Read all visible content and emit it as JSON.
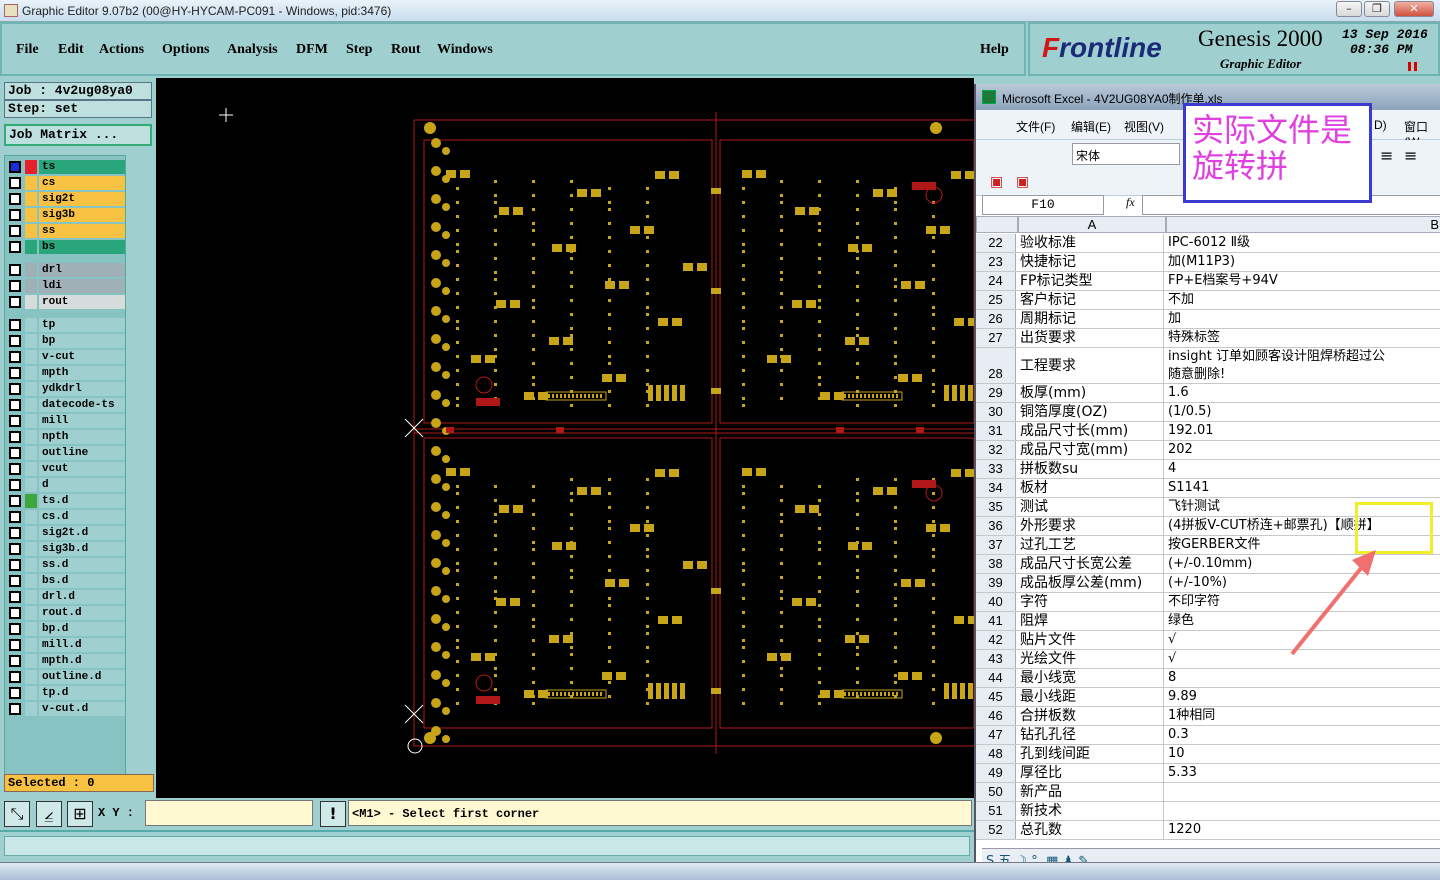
{
  "window": {
    "title": "Graphic Editor 9.07b2 (00@HY-HYCAM-PC091 - Windows, pid:3476)",
    "controls": [
      "–",
      "❐",
      "✕"
    ]
  },
  "menu": {
    "items": [
      "File",
      "Edit",
      "Actions",
      "Options",
      "Analysis",
      "DFM",
      "Step",
      "Rout",
      "Windows"
    ],
    "help": "Help"
  },
  "brand": {
    "logo_prefix": "F",
    "logo_rest": "rontline",
    "product": "Genesis 2000",
    "subtitle": "Graphic Editor",
    "date_line1": "13 Sep 2016",
    "date_line2": "08:36 PM"
  },
  "job": {
    "job_label": "Job : 4v2ug08ya0",
    "step_label": "Step: set",
    "matrix_button": "Job Matrix ..."
  },
  "layers": [
    {
      "name": "ts",
      "color": "#2aa67c",
      "mark": "#e8202a",
      "active": true
    },
    {
      "name": "cs",
      "color": "#f7c141"
    },
    {
      "name": "sig2t",
      "color": "#f7c141"
    },
    {
      "name": "sig3b",
      "color": "#f7c141"
    },
    {
      "name": "ss",
      "color": "#f7c141"
    },
    {
      "name": "bs",
      "color": "#2aa67c"
    },
    {
      "name": "drl",
      "color": "#9fb0b6"
    },
    {
      "name": "ldi",
      "color": "#9fb0b6"
    },
    {
      "name": "rout",
      "color": "#d6dcdc"
    },
    {
      "name": "tp",
      "color": "#9fd0cf"
    },
    {
      "name": "bp",
      "color": "#9fd0cf"
    },
    {
      "name": "v-cut",
      "color": "#9fd0cf"
    },
    {
      "name": "mpth",
      "color": "#9fd0cf"
    },
    {
      "name": "ydkdrl",
      "color": "#9fd0cf"
    },
    {
      "name": "datecode-ts",
      "color": "#9fd0cf"
    },
    {
      "name": "mill",
      "color": "#9fd0cf"
    },
    {
      "name": "npth",
      "color": "#9fd0cf"
    },
    {
      "name": "outline",
      "color": "#9fd0cf"
    },
    {
      "name": "vcut",
      "color": "#9fd0cf"
    },
    {
      "name": "d",
      "color": "#9fd0cf"
    },
    {
      "name": "ts.d",
      "color": "#9fd0cf",
      "mark": "#3fa63f"
    },
    {
      "name": "cs.d",
      "color": "#9fd0cf",
      "pen": true
    },
    {
      "name": "sig2t.d",
      "color": "#9fd0cf",
      "pen": true
    },
    {
      "name": "sig3b.d",
      "color": "#9fd0cf",
      "pen": true
    },
    {
      "name": "ss.d",
      "color": "#9fd0cf",
      "pen": true
    },
    {
      "name": "bs.d",
      "color": "#9fd0cf"
    },
    {
      "name": "drl.d",
      "color": "#9fd0cf"
    },
    {
      "name": "rout.d",
      "color": "#9fd0cf"
    },
    {
      "name": "bp.d",
      "color": "#9fd0cf"
    },
    {
      "name": "mill.d",
      "color": "#9fd0cf",
      "pen": true
    },
    {
      "name": "mpth.d",
      "color": "#9fd0cf"
    },
    {
      "name": "outline.d",
      "color": "#9fd0cf"
    },
    {
      "name": "tp.d",
      "color": "#9fd0cf"
    },
    {
      "name": "v-cut.d",
      "color": "#9fd0cf"
    }
  ],
  "selected": "Selected : 0",
  "coord": {
    "label": "X Y :",
    "value": ""
  },
  "prompt": "<M1> - Select first corner",
  "excel": {
    "title": "Microsoft Excel - 4V2UG08YA0制作单.xls",
    "menus": [
      "文件(F)",
      "编辑(E)",
      "视图(V)",
      "D)",
      "窗口(W"
    ],
    "font_name": "宋体",
    "cell_ref": "F10",
    "fx": "fx",
    "col_a": "A",
    "col_b": "B",
    "rows": [
      {
        "n": "22",
        "a": "验收标准",
        "b": "IPC-6012 Ⅱ级"
      },
      {
        "n": "23",
        "a": "快捷标记",
        "b": "加(M11P3)"
      },
      {
        "n": "24",
        "a": "FP标记类型",
        "b": "FP+E档案号+94V"
      },
      {
        "n": "25",
        "a": "客户标记",
        "b": "不加"
      },
      {
        "n": "26",
        "a": "周期标记",
        "b": "加"
      },
      {
        "n": "27",
        "a": "出货要求",
        "b": "特殊标签"
      },
      {
        "n": "28",
        "a": "工程要求",
        "b": "insight 订单如顾客设计阻焊桥超过公",
        "b2": "随意删除!"
      },
      {
        "n": "29",
        "a": "板厚(mm)",
        "b": "1.6"
      },
      {
        "n": "30",
        "a": "铜箔厚度(OZ)",
        "b": " (1/0.5)"
      },
      {
        "n": "31",
        "a": "成品尺寸长(mm)",
        "b": "192.01"
      },
      {
        "n": "32",
        "a": "成品尺寸宽(mm)",
        "b": "202"
      },
      {
        "n": "33",
        "a": "拼板数su",
        "b": "4"
      },
      {
        "n": "34",
        "a": "板材",
        "b": "S1141"
      },
      {
        "n": "35",
        "a": "测试",
        "b": "飞针测试"
      },
      {
        "n": "36",
        "a": "外形要求",
        "b": "(4拼板V-CUT桥连+邮票孔)【顺拼】"
      },
      {
        "n": "37",
        "a": "过孔工艺",
        "b": "按GERBER文件"
      },
      {
        "n": "38",
        "a": "成品尺寸长宽公差",
        "b": "(+/-0.10mm)"
      },
      {
        "n": "39",
        "a": "成品板厚公差(mm)",
        "b": "(+/-10%)"
      },
      {
        "n": "40",
        "a": "字符",
        "b": "不印字符"
      },
      {
        "n": "41",
        "a": "阻焊",
        "b": "绿色"
      },
      {
        "n": "42",
        "a": "贴片文件",
        "b": "√"
      },
      {
        "n": "43",
        "a": "光绘文件",
        "b": "√"
      },
      {
        "n": "44",
        "a": "最小线宽",
        "b": "8"
      },
      {
        "n": "45",
        "a": "最小线距",
        "b": "9.89"
      },
      {
        "n": "46",
        "a": "合拼板数",
        "b": "1种相同"
      },
      {
        "n": "47",
        "a": "钻孔孔径",
        "b": "0.3"
      },
      {
        "n": "48",
        "a": "孔到线间距",
        "b": "10"
      },
      {
        "n": "49",
        "a": "厚径比",
        "b": "5.33"
      },
      {
        "n": "50",
        "a": "新产品",
        "b": ""
      },
      {
        "n": "51",
        "a": "新技术",
        "b": ""
      },
      {
        "n": "52",
        "a": "总孔数",
        "b": "1220"
      }
    ],
    "status_icons": "S 五 ☽ °, ▦ ♟ ✎"
  },
  "annotation": {
    "text_line1": "实际文件是",
    "text_line2": "旋转拼"
  },
  "colors": {
    "pad": "#c8a418",
    "outline": "#b01818",
    "panel": "#9fd0cf",
    "note_text": "#e040e0",
    "highlight": "#f2ee2a",
    "arrow": "#f07070"
  }
}
